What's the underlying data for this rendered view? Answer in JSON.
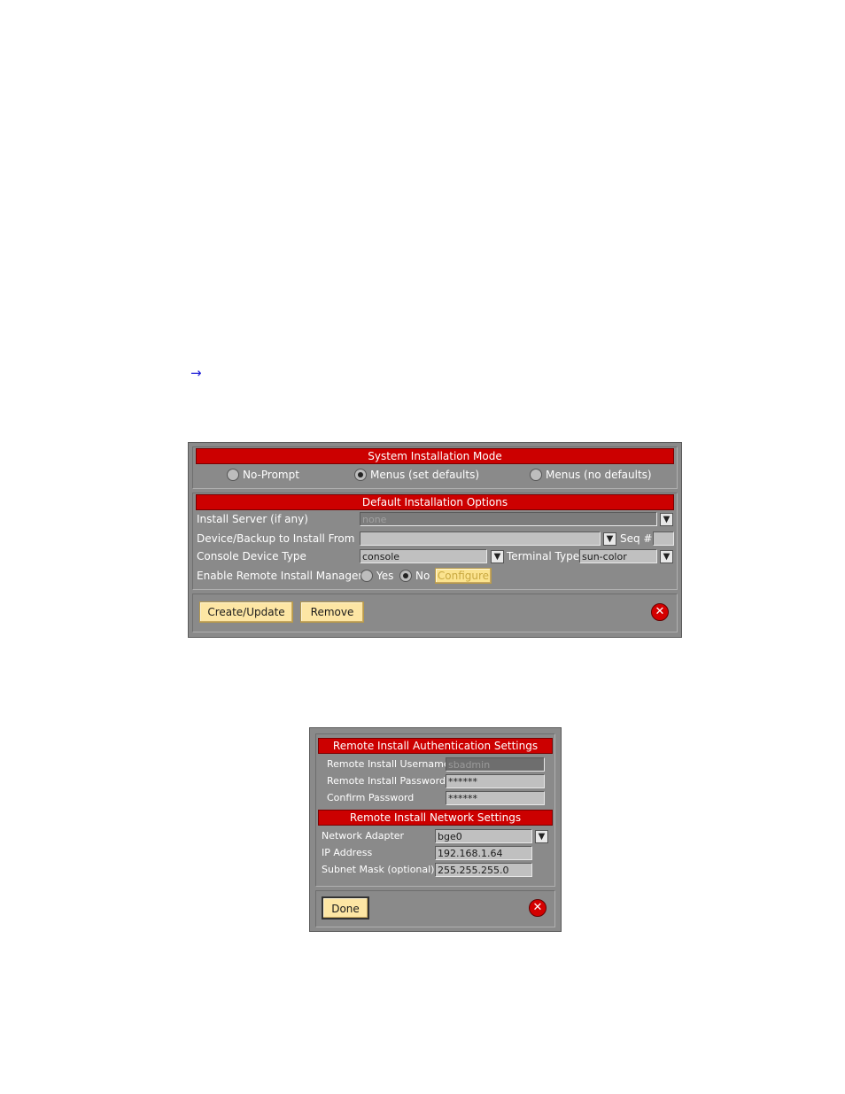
{
  "arrow": "→",
  "main": {
    "mode": {
      "title": "System Installation Mode",
      "options": [
        "No-Prompt",
        "Menus (set defaults)",
        "Menus (no defaults)"
      ]
    },
    "defaults": {
      "title": "Default Installation Options",
      "install_server_label": "Install Server (if any)",
      "install_server_value": "none",
      "device_label": "Device/Backup to Install From",
      "device_value": "",
      "seq_label": "Seq #",
      "console_label": "Console Device Type",
      "console_value": "console",
      "terminal_label": "Terminal Type",
      "terminal_value": "sun-color",
      "remote_label": "Enable Remote Install Manager?",
      "yes_label": "Yes",
      "no_label": "No",
      "configure_label": "Configure"
    },
    "buttons": {
      "create": "Create/Update",
      "remove": "Remove"
    }
  },
  "remote": {
    "auth_title": "Remote Install Authentication Settings",
    "username_label": "Remote Install Username",
    "username_value": "sbadmin",
    "password_label": "Remote Install Password",
    "password_value": "******",
    "confirm_label": "Confirm Password",
    "confirm_value": "******",
    "net_title": "Remote Install Network Settings",
    "adapter_label": "Network Adapter",
    "adapter_value": "bge0",
    "ip_label": "IP Address",
    "ip_value": "192.168.1.64",
    "mask_label": "Subnet Mask (optional)",
    "mask_value": "255.255.255.0",
    "done": "Done"
  },
  "colors": {
    "header": "#cc0000",
    "panel": "#8a8a8a",
    "button": "#fde6a4"
  }
}
